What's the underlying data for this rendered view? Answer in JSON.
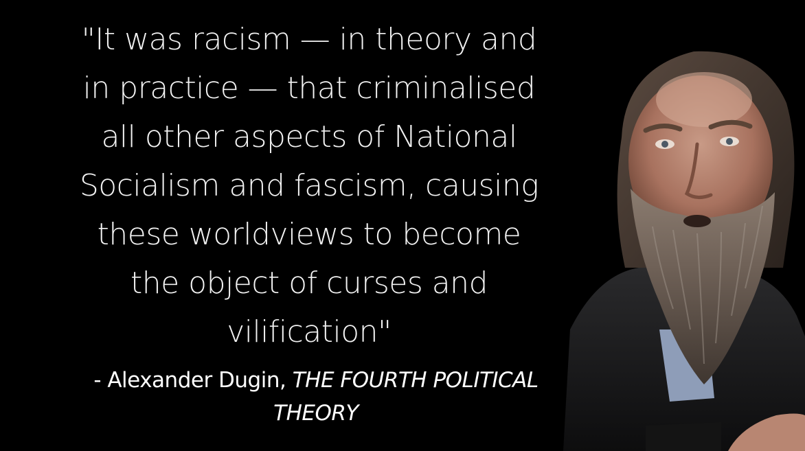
{
  "quote": {
    "lines": [
      "\"It was racism — in theory and",
      "in practice — that criminalised",
      "all other aspects of National",
      "Socialism and fascism, causing",
      "these worldviews to become",
      "the object of curses and",
      "vilification\""
    ]
  },
  "attribution": {
    "author": "- Alexander Dugin, ",
    "book_line1": "THE FOURTH POLITICAL",
    "book_line2": "THEORY"
  },
  "portrait": {
    "subject": "bearded man portrait"
  },
  "colors": {
    "background": "#000000",
    "text": "#f2f2f2"
  }
}
